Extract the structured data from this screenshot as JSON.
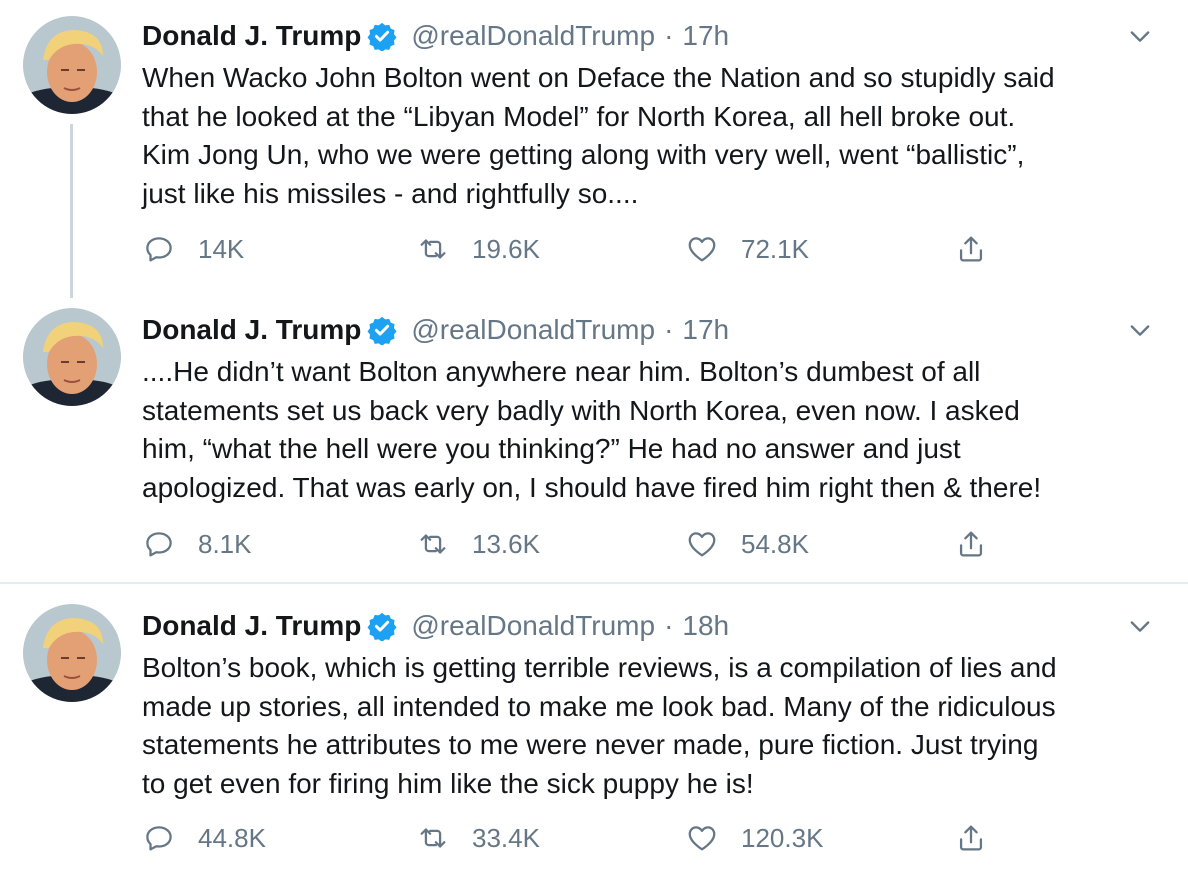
{
  "colors": {
    "text": "#14171a",
    "secondary": "#657786",
    "verified_blue": "#1da1f2",
    "thread_line": "#ccd6dd",
    "divider": "#e6ecf0"
  },
  "icons": {
    "verified": "verified-badge-icon",
    "caret": "chevron-down-icon",
    "reply": "reply-icon",
    "retweet": "retweet-icon",
    "like": "heart-icon",
    "share": "share-icon"
  },
  "tweets": [
    {
      "author_name": "Donald J. Trump",
      "handle": "@realDonaldTrump",
      "separator": "·",
      "time": "17h",
      "lines": [
        "When Wacko John Bolton went on Deface the Nation and so stupidly said",
        "that he looked at the “Libyan Model” for North Korea, all hell broke out.",
        "Kim Jong Un, who we were getting along with very well, went “ballistic”,",
        "just like his missiles - and rightfully so...."
      ],
      "replies": "14K",
      "retweets": "19.6K",
      "likes": "72.1K"
    },
    {
      "author_name": "Donald J. Trump",
      "handle": "@realDonaldTrump",
      "separator": "·",
      "time": "17h",
      "lines": [
        "....He didn’t want Bolton anywhere near him. Bolton’s dumbest of all",
        "statements set us back very badly with North Korea, even now. I asked",
        "him, “what the hell were you thinking?” He had no answer and just",
        "apologized. That was early on, I should have fired him right then & there!"
      ],
      "replies": "8.1K",
      "retweets": "13.6K",
      "likes": "54.8K"
    },
    {
      "author_name": "Donald J. Trump",
      "handle": "@realDonaldTrump",
      "separator": "·",
      "time": "18h",
      "lines": [
        "Bolton’s book, which is getting terrible reviews, is a compilation of lies and",
        "made up stories, all intended to make me look bad. Many of the ridiculous",
        "statements he attributes to me were never made, pure fiction. Just trying",
        "to get even for firing him like the sick puppy he is!"
      ],
      "replies": "44.8K",
      "retweets": "33.4K",
      "likes": "120.3K"
    }
  ]
}
